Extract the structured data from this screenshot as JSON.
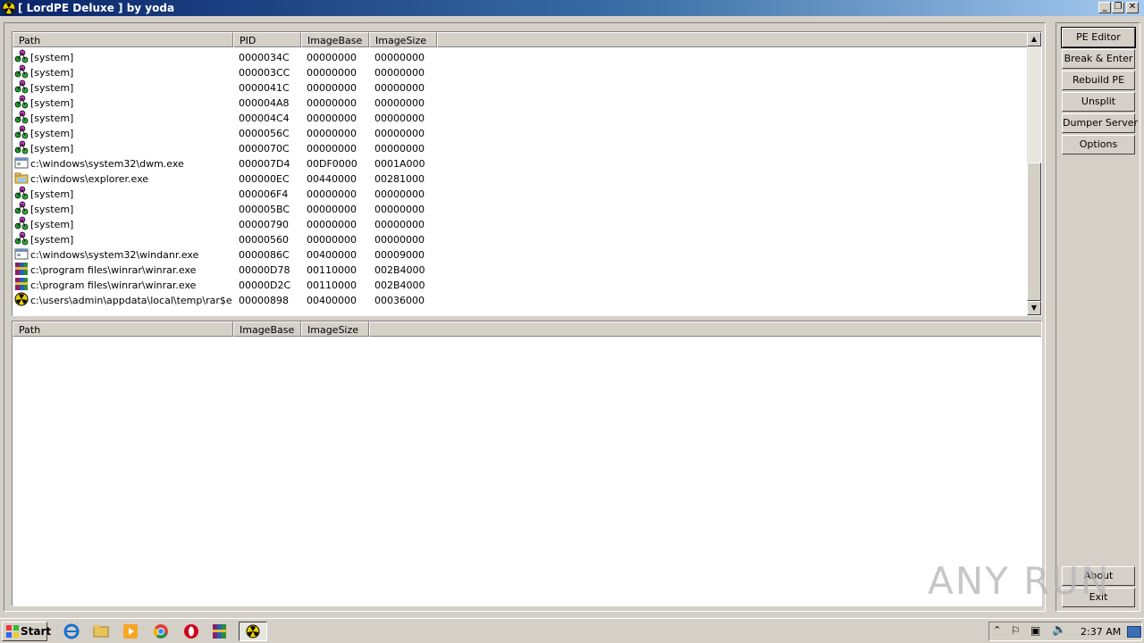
{
  "window": {
    "title": "[ LordPE Deluxe ] by yoda",
    "minimize": "_",
    "restore": "❐",
    "close": "✕"
  },
  "processes": {
    "headers": [
      "Path",
      "PID",
      "ImageBase",
      "ImageSize"
    ],
    "rows": [
      {
        "path": "[system]",
        "pid": "0000034C",
        "base": "00000000",
        "size": "00000000",
        "icon": "system-icon"
      },
      {
        "path": "[system]",
        "pid": "000003CC",
        "base": "00000000",
        "size": "00000000",
        "icon": "system-icon"
      },
      {
        "path": "[system]",
        "pid": "0000041C",
        "base": "00000000",
        "size": "00000000",
        "icon": "system-icon"
      },
      {
        "path": "[system]",
        "pid": "000004A8",
        "base": "00000000",
        "size": "00000000",
        "icon": "system-icon"
      },
      {
        "path": "[system]",
        "pid": "000004C4",
        "base": "00000000",
        "size": "00000000",
        "icon": "system-icon"
      },
      {
        "path": "[system]",
        "pid": "0000056C",
        "base": "00000000",
        "size": "00000000",
        "icon": "system-icon"
      },
      {
        "path": "[system]",
        "pid": "0000070C",
        "base": "00000000",
        "size": "00000000",
        "icon": "system-icon"
      },
      {
        "path": "c:\\windows\\system32\\dwm.exe",
        "pid": "000007D4",
        "base": "00DF0000",
        "size": "0001A000",
        "icon": "window-app-icon"
      },
      {
        "path": "c:\\windows\\explorer.exe",
        "pid": "000000EC",
        "base": "00440000",
        "size": "00281000",
        "icon": "explorer-icon"
      },
      {
        "path": "[system]",
        "pid": "000006F4",
        "base": "00000000",
        "size": "00000000",
        "icon": "system-icon"
      },
      {
        "path": "[system]",
        "pid": "000005BC",
        "base": "00000000",
        "size": "00000000",
        "icon": "system-icon"
      },
      {
        "path": "[system]",
        "pid": "00000790",
        "base": "00000000",
        "size": "00000000",
        "icon": "system-icon"
      },
      {
        "path": "[system]",
        "pid": "00000560",
        "base": "00000000",
        "size": "00000000",
        "icon": "system-icon"
      },
      {
        "path": "c:\\windows\\system32\\windanr.exe",
        "pid": "0000086C",
        "base": "00400000",
        "size": "00009000",
        "icon": "window-app-icon"
      },
      {
        "path": "c:\\program files\\winrar\\winrar.exe",
        "pid": "00000D78",
        "base": "00110000",
        "size": "002B4000",
        "icon": "winrar-icon"
      },
      {
        "path": "c:\\program files\\winrar\\winrar.exe",
        "pid": "00000D2C",
        "base": "00110000",
        "size": "002B4000",
        "icon": "winrar-icon"
      },
      {
        "path": "c:\\users\\admin\\appdata\\local\\temp\\rar$exa...",
        "pid": "00000898",
        "base": "00400000",
        "size": "00036000",
        "icon": "lordpe-icon"
      }
    ]
  },
  "modules": {
    "headers": [
      "Path",
      "ImageBase",
      "ImageSize"
    ]
  },
  "buttons": {
    "pe_editor": "PE Editor",
    "break_enter": "Break & Enter",
    "rebuild_pe": "Rebuild PE",
    "unsplit": "Unsplit",
    "dumper_server": "Dumper Server",
    "options": "Options",
    "about": "About",
    "exit": "Exit"
  },
  "taskbar": {
    "start": "Start",
    "clock": "2:37 AM"
  },
  "watermark": "ANY RUN"
}
